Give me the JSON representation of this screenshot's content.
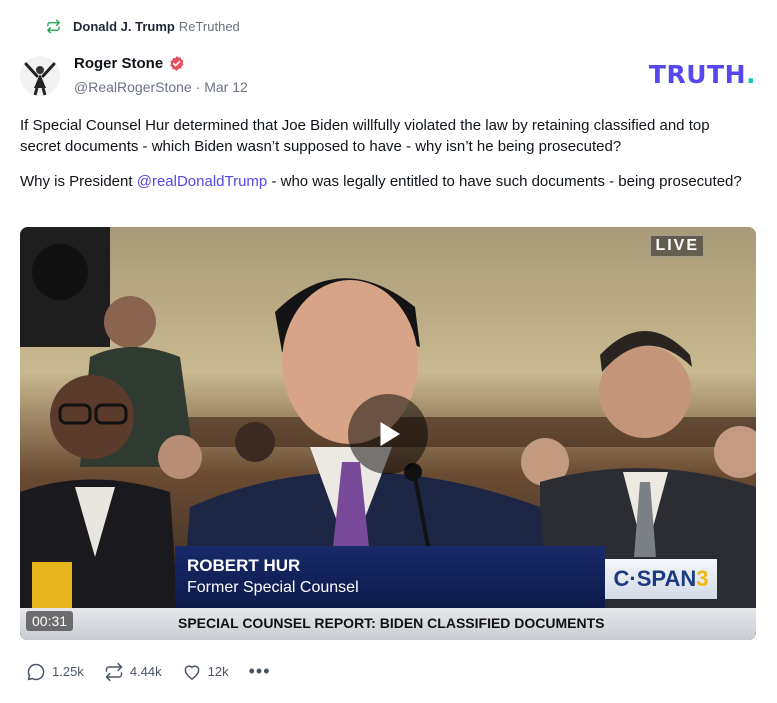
{
  "retruth": {
    "user": "Donald J. Trump",
    "action": "ReTruthed",
    "icon": "retruth-icon"
  },
  "author": {
    "name": "Roger Stone",
    "handle": "@RealRogerStone",
    "separator": "·",
    "date": "Mar 12",
    "verified": true
  },
  "brand": {
    "logo_text": "TRUTH",
    "logo_dot": ".",
    "color": "#5448ee",
    "dot_color": "#18c7b8"
  },
  "post": {
    "paragraph1": "If Special Counsel Hur determined that Joe Biden willfully violated the law by retaining classified and top secret documents - which Biden wasn’t supposed to have - why isn’t he being prosecuted?",
    "paragraph2_before": "Why is President ",
    "paragraph2_mention": "@realDonaldTrump",
    "paragraph2_after": " - who was legally entitled to have such documents - being prosecuted?"
  },
  "video": {
    "live_badge": "LIVE",
    "lower_third_name": "ROBERT HUR",
    "lower_third_title": "Former Special Counsel",
    "network_name": "C·SPAN",
    "network_number": "3",
    "ticker": "SPECIAL COUNSEL REPORT: BIDEN CLASSIFIED DOCUMENTS",
    "duration": "00:31"
  },
  "actions": {
    "replies": "1.25k",
    "retruths": "4.44k",
    "likes": "12k",
    "more": "•••"
  }
}
